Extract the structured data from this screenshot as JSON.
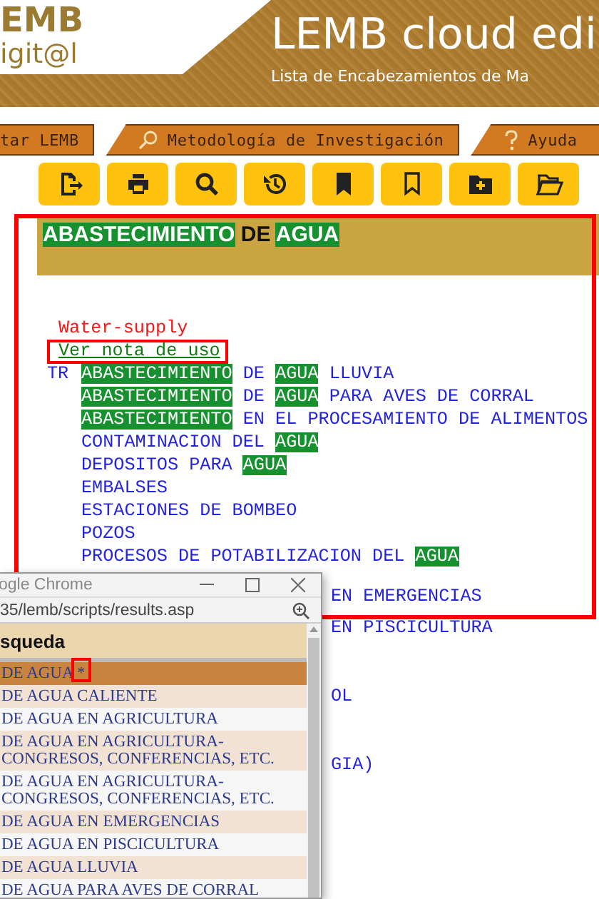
{
  "header": {
    "logo_top": "EMB",
    "logo_bottom": "igit@l",
    "title": "LEMB cloud edi",
    "subtitle": "Lista de Encabezamientos de Ma"
  },
  "tabs": [
    {
      "label": "tar LEMB",
      "selected": false
    },
    {
      "label": "Metodología de Investigación",
      "selected": false
    },
    {
      "label": "Ayuda",
      "selected": false
    }
  ],
  "toolbar": [
    {
      "kind": "export"
    },
    {
      "kind": "print"
    },
    {
      "kind": "search"
    },
    {
      "kind": "history"
    },
    {
      "kind": "bookmark-filled"
    },
    {
      "kind": "bookmark"
    },
    {
      "kind": "folder-add"
    },
    {
      "kind": "folder-open"
    }
  ],
  "record": {
    "heading": [
      {
        "text": "ABASTECIMIENTO",
        "match": true
      },
      {
        "text": "DE",
        "match": false
      },
      {
        "text": "AGUA",
        "match": true
      }
    ],
    "english": "Water-supply",
    "note_link": "Ver nota de uso",
    "related_tag": "TR",
    "related": [
      {
        "segments": [
          {
            "text": "ABASTECIMIENTO",
            "match": true
          },
          {
            "text": "DE",
            "match": false
          },
          {
            "text": "AGUA",
            "match": true
          },
          {
            "text": "LLUVIA",
            "match": false
          }
        ]
      },
      {
        "segments": [
          {
            "text": "ABASTECIMIENTO",
            "match": true
          },
          {
            "text": "DE",
            "match": false
          },
          {
            "text": "AGUA",
            "match": true
          },
          {
            "text": "PARA AVES DE CORRAL",
            "match": false
          }
        ]
      },
      {
        "segments": [
          {
            "text": "ABASTECIMIENTO",
            "match": true
          },
          {
            "text": "EN EL PROCESAMIENTO DE ALIMENTOS",
            "match": false
          }
        ]
      },
      {
        "segments": [
          {
            "text": "CONTAMINACION DEL",
            "match": false
          },
          {
            "text": "AGUA",
            "match": true
          }
        ]
      },
      {
        "segments": [
          {
            "text": "DEPOSITOS PARA",
            "match": false
          },
          {
            "text": "AGUA",
            "match": true
          }
        ]
      },
      {
        "segments": [
          {
            "text": "EMBALSES",
            "match": false
          }
        ]
      },
      {
        "segments": [
          {
            "text": "ESTACIONES DE BOMBEO",
            "match": false
          }
        ]
      },
      {
        "segments": [
          {
            "text": "POZOS",
            "match": false
          }
        ]
      },
      {
        "segments": [
          {
            "text": "PROCESOS DE POTABILIZACION DEL",
            "match": false
          },
          {
            "text": "AGUA",
            "match": true
          }
        ]
      }
    ],
    "partly_hidden": [
      "EN EMERGENCIAS",
      "EN PISCICULTURA",
      "OL",
      "GIA)"
    ]
  },
  "popup": {
    "title": "ogle Chrome",
    "address": "35/lemb/scripts/results.asp",
    "heading": "squeda",
    "rows": [
      {
        "text": "DE AGUA *",
        "selected": true
      },
      {
        "text": "DE AGUA CALIENTE",
        "selected": false
      },
      {
        "text": "DE AGUA EN AGRICULTURA",
        "selected": false
      },
      {
        "text": "DE AGUA EN AGRICULTURA-CONGRESOS, CONFERENCIAS, ETC.",
        "selected": false
      },
      {
        "text": "DE AGUA EN AGRICULTURA-CONGRESOS, CONFERENCIAS, ETC.",
        "selected": false
      },
      {
        "text": "DE AGUA EN EMERGENCIAS",
        "selected": false
      },
      {
        "text": "DE AGUA EN PISCICULTURA",
        "selected": false
      },
      {
        "text": "DE AGUA LLUVIA",
        "selected": false
      },
      {
        "text": "DE AGUA PARA AVES DE CORRAL",
        "selected": false
      }
    ]
  }
}
